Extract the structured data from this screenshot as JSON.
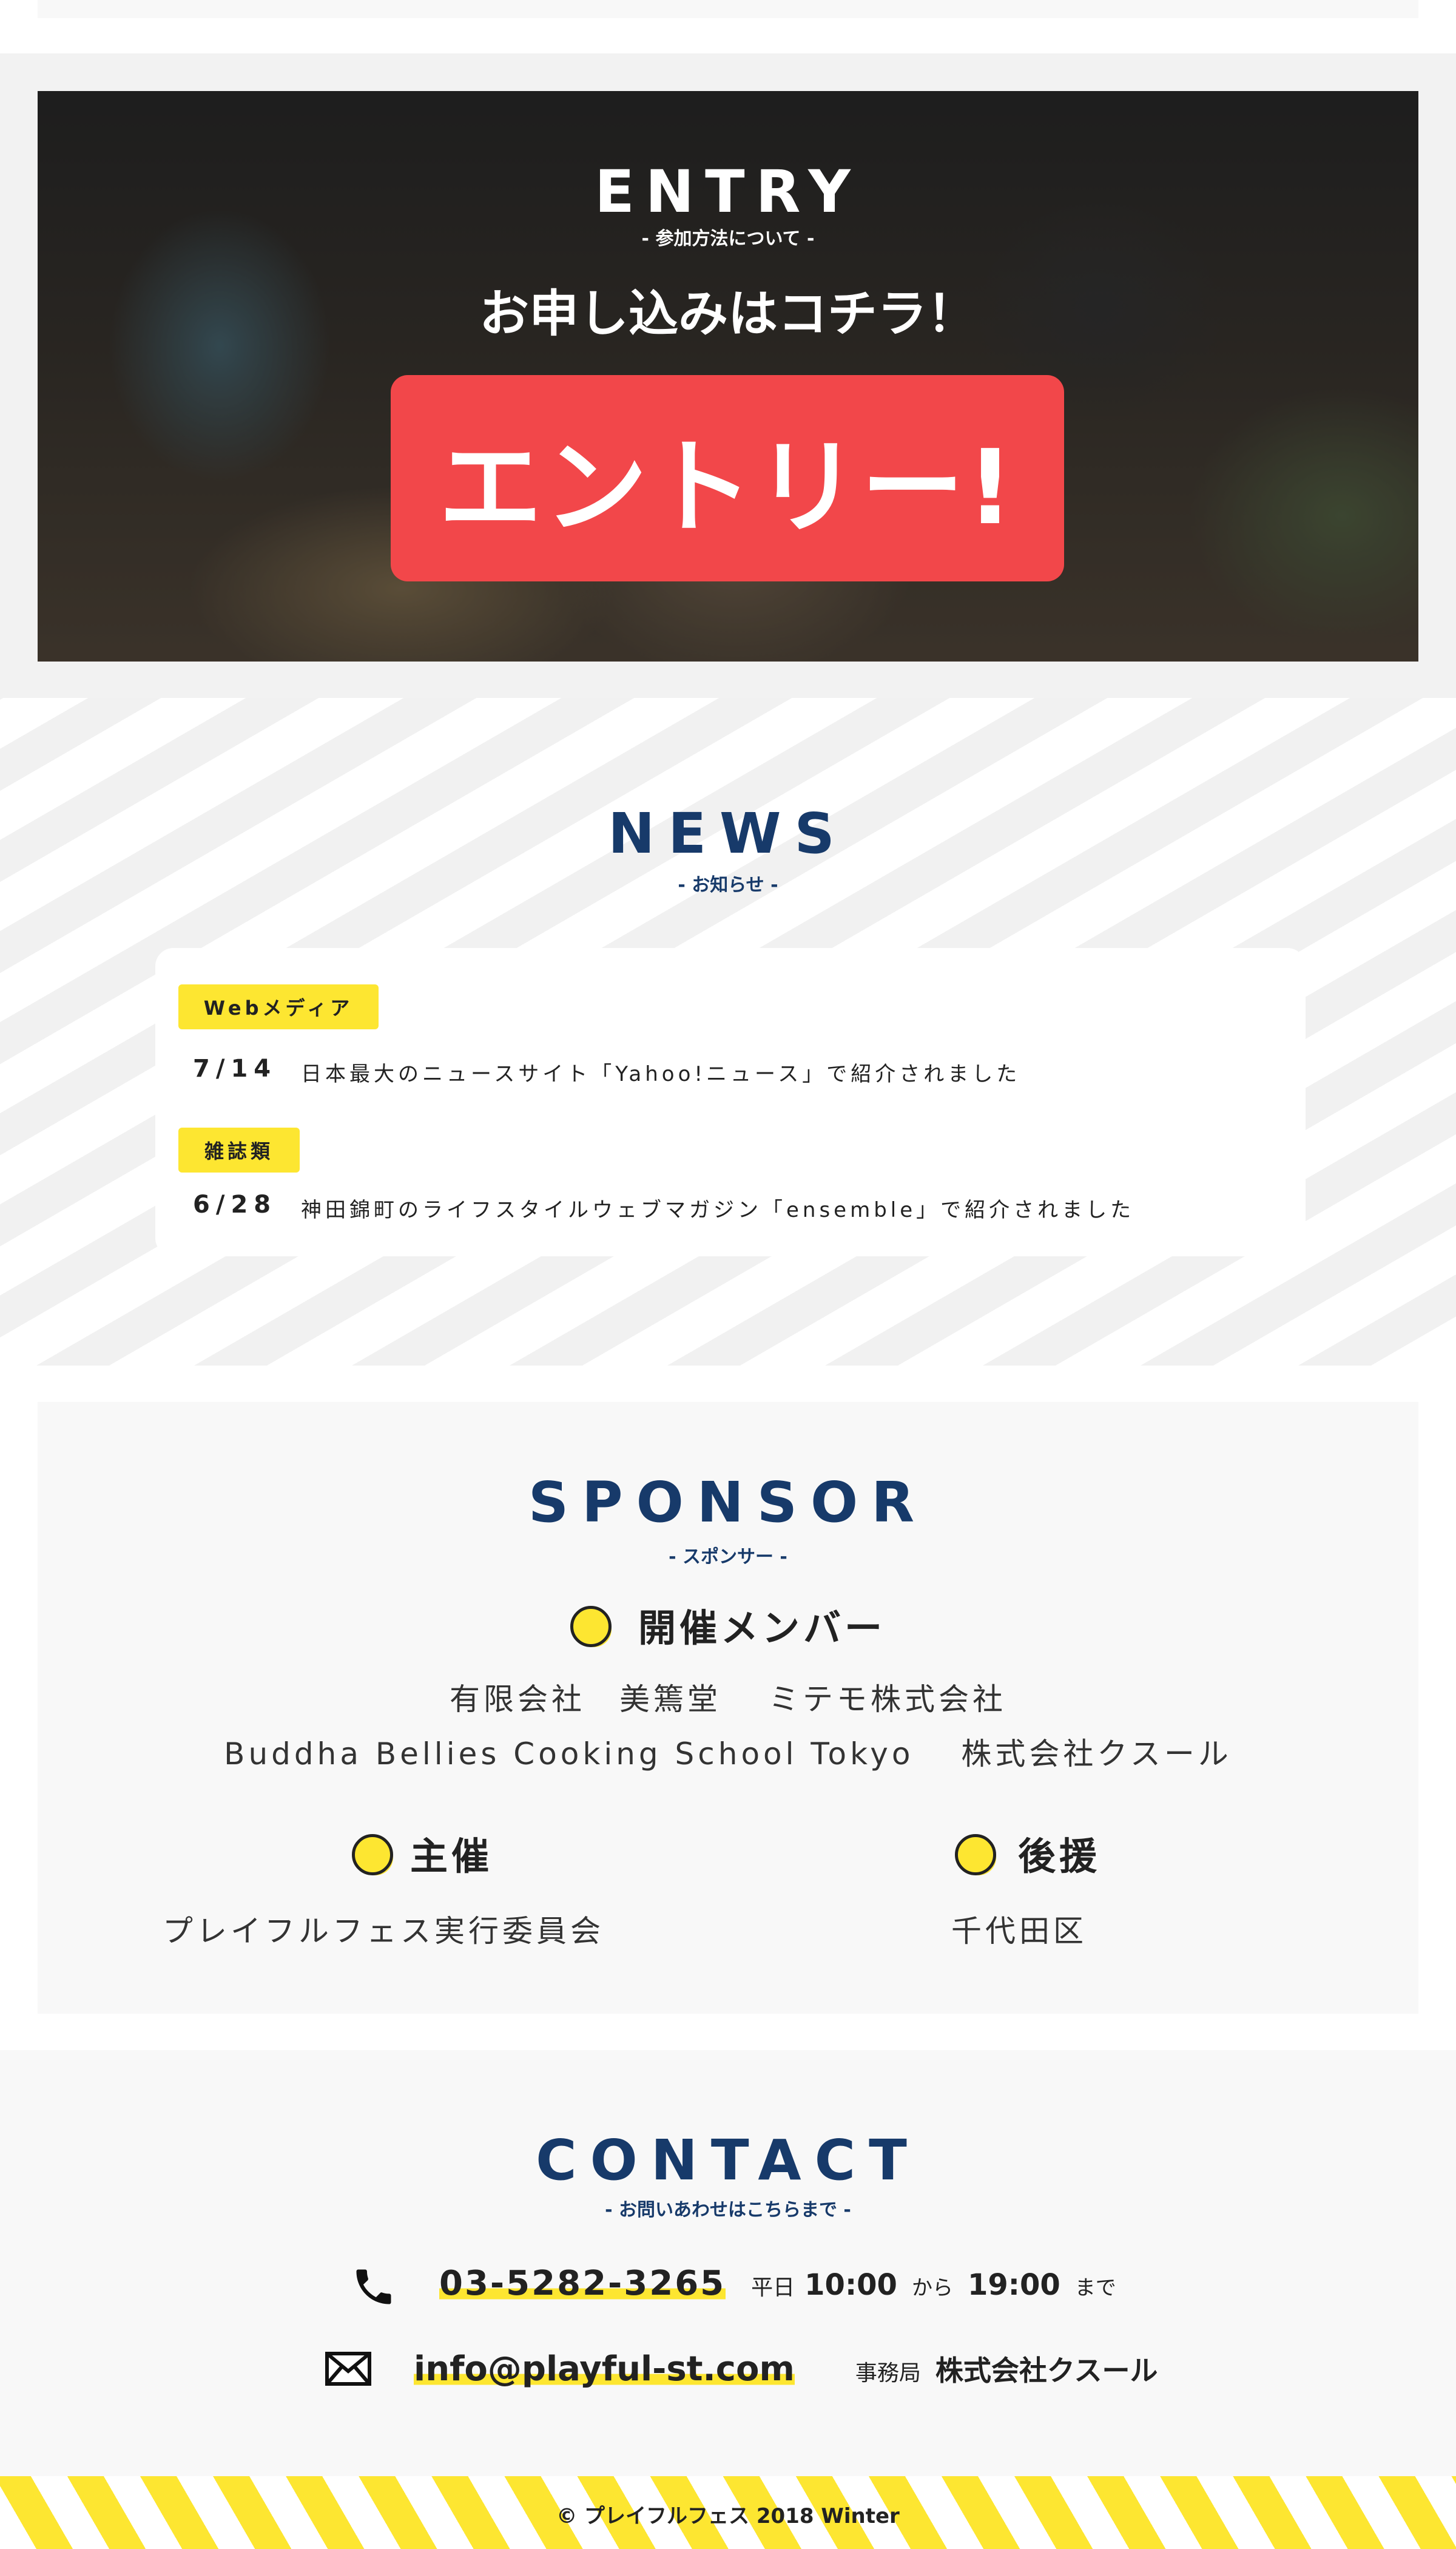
{
  "entry": {
    "title": "ENTRY",
    "subtitle": "- 参加方法について -",
    "lead": "お申し込みはコチラ！",
    "button_label": "エントリー!"
  },
  "news": {
    "title": "NEWS",
    "subtitle": "- お知らせ -",
    "items": [
      {
        "tag": "Webメディア",
        "date": "7/14",
        "text": "日本最大のニュースサイト「Yahoo!ニュース」で紹介されました"
      },
      {
        "tag": "雑誌類",
        "date": "6/28",
        "text": "神田錦町のライフスタイルウェブマガジン「ensemble」で紹介されました"
      }
    ]
  },
  "sponsor": {
    "title": "SPONSOR",
    "subtitle": "- スポンサー -",
    "members_heading": "開催メンバー",
    "members_line1": "有限会社　美篶堂　 ミテモ株式会社",
    "members_line2": "Buddha Bellies Cooking School Tokyo　 株式会社クスール",
    "organizer_heading": "主催",
    "organizer": "プレイフルフェス実行委員会",
    "support_heading": "後援",
    "support": "千代田区"
  },
  "contact": {
    "title": "CONTACT",
    "subtitle": "- お問いあわせはこちらまで -",
    "phone": "03-5282-3265",
    "weekday": "平日",
    "open": "10:00",
    "from": "から",
    "close": "19:00",
    "until": "まで",
    "email": "info@playful-st.com",
    "office_label": "事務局",
    "office": "株式会社クスール"
  },
  "footer": {
    "copyright": "© プレイフルフェス 2018 Winter"
  },
  "colors": {
    "navy": "#173a6a",
    "yellow": "#fde631",
    "red": "#f2474a"
  },
  "icons": [
    "phone-icon",
    "mail-icon"
  ]
}
